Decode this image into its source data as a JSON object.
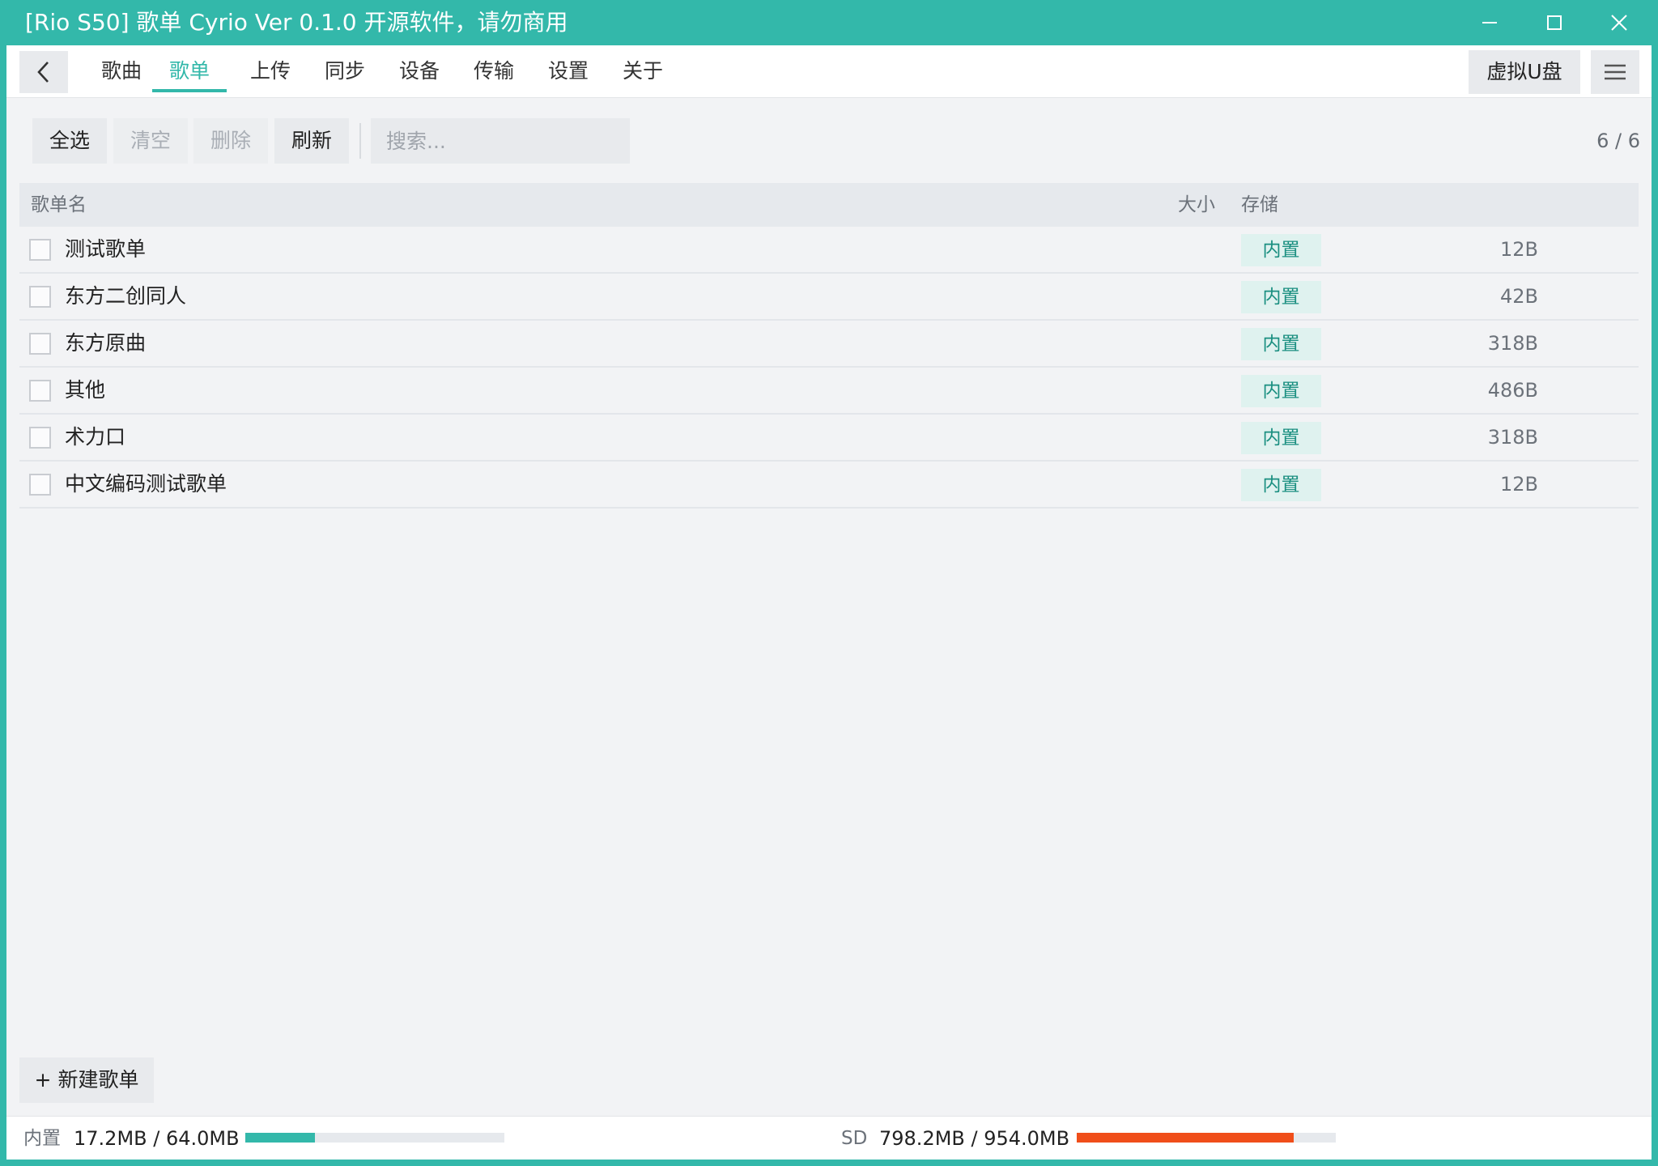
{
  "window": {
    "title": "[Rio S50] 歌单 Cyrio Ver 0.1.0 开源软件，请勿商用",
    "controls": [
      "minimize-icon",
      "maximize-icon",
      "close-icon"
    ]
  },
  "nav": {
    "back_icon": "chevron-left-icon",
    "tabs": [
      {
        "label": "歌曲",
        "active": false
      },
      {
        "label": "歌单",
        "active": true
      },
      {
        "label": "上传",
        "active": false
      },
      {
        "label": "同步",
        "active": false
      },
      {
        "label": "设备",
        "active": false
      },
      {
        "label": "传输",
        "active": false
      },
      {
        "label": "设置",
        "active": false
      },
      {
        "label": "关于",
        "active": false
      }
    ],
    "usb_button": "虚拟U盘",
    "menu_icon": "hamburger-menu-icon"
  },
  "toolbar": {
    "select_all": "全选",
    "clear": "清空",
    "delete": "删除",
    "refresh": "刷新",
    "search_placeholder": "搜索...",
    "count": "6 / 6"
  },
  "table": {
    "columns": {
      "name": "歌单名",
      "size": "大小",
      "storage": "存储"
    },
    "rows": [
      {
        "name": "测试歌单",
        "size": "12B",
        "storage": "内置"
      },
      {
        "name": "东方二创同人",
        "size": "42B",
        "storage": "内置"
      },
      {
        "name": "东方原曲",
        "size": "318B",
        "storage": "内置"
      },
      {
        "name": "其他",
        "size": "486B",
        "storage": "内置"
      },
      {
        "name": "术力口",
        "size": "318B",
        "storage": "内置"
      },
      {
        "name": "中文编码测试歌单",
        "size": "12B",
        "storage": "内置"
      }
    ]
  },
  "new_playlist_button": "+ 新建歌单",
  "status": {
    "internal": {
      "label": "内置",
      "value": "17.2MB / 64.0MB",
      "fraction": 0.269,
      "color": "#33b8aa"
    },
    "sd": {
      "label": "SD",
      "value": "798.2MB / 954.0MB",
      "fraction": 0.837,
      "color": "#f04e1a"
    }
  },
  "colors": {
    "accent": "#33b8aa",
    "badge_text": "#1a8f80",
    "badge_bg": "#dff2ef"
  }
}
